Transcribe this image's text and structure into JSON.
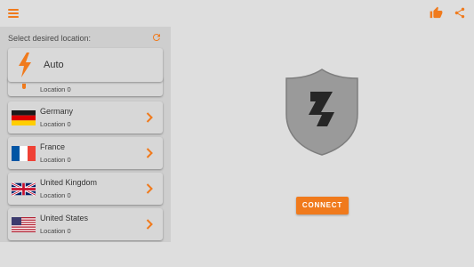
{
  "colors": {
    "accent": "#f07a1c",
    "panel_bg": "#cecece",
    "screen_bg": "#dedede",
    "shield": "#9a9a9a"
  },
  "topbar": {
    "menu_icon": "hamburger-menu-icon",
    "like_icon": "thumbs-up-icon",
    "share_icon": "share-icon"
  },
  "locations_panel": {
    "title": "Select desired location:",
    "refresh_icon": "refresh-icon",
    "auto": {
      "label": "Auto",
      "icon": "lightning-bolt-icon"
    },
    "partial_item": {
      "subtitle": "Location 0"
    },
    "countries": [
      {
        "name": "Germany",
        "subtitle": "Location 0",
        "flag": "germany-flag-icon"
      },
      {
        "name": "France",
        "subtitle": "Location 0",
        "flag": "france-flag-icon"
      },
      {
        "name": "United Kingdom",
        "subtitle": "Location 0",
        "flag": "uk-flag-icon"
      },
      {
        "name": "United States",
        "subtitle": "Location 0",
        "flag": "us-flag-icon"
      }
    ]
  },
  "main": {
    "shield_icon": "shield-bolt-icon",
    "connect_label": "CONNECT"
  }
}
